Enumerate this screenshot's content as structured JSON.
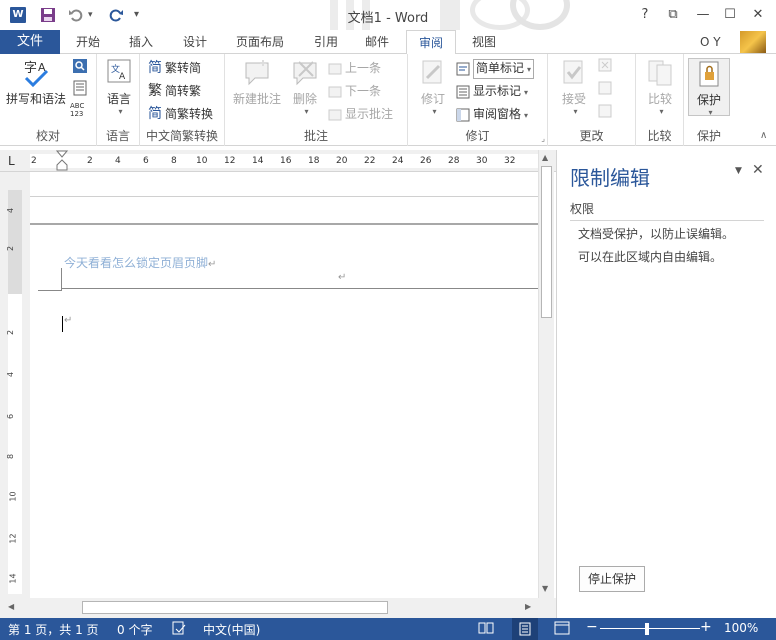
{
  "titlebar": {
    "title": "文档1 - Word",
    "logo": "W",
    "help": "?",
    "restore": "⧉",
    "minimize": "—",
    "maximize": "☐",
    "close": "✕"
  },
  "tabs": {
    "file": "文件",
    "items": [
      "开始",
      "插入",
      "设计",
      "页面布局",
      "引用",
      "邮件",
      "审阅",
      "视图"
    ],
    "active": "审阅",
    "user": "O Y"
  },
  "ribbon": {
    "proofing": {
      "label": "校对",
      "spelling": "拼写和语法",
      "abc": "ABC\n123"
    },
    "language": {
      "label": "语言"
    },
    "chinese": {
      "label": "中文简繁转换",
      "to_simplified": "繁转简",
      "to_traditional": "简转繁",
      "convert": "简繁转换",
      "icon_to_simplified": "简",
      "icon_to_traditional": "繁",
      "icon_convert": "简"
    },
    "comments": {
      "label": "批注",
      "new": "新建批注",
      "delete": "删除",
      "previous": "上一条",
      "next": "下一条",
      "show": "显示批注"
    },
    "tracking": {
      "label": "修订",
      "track": "修订",
      "simple_markup": "简单标记",
      "show_markup": "显示标记",
      "reviewing_pane": "审阅窗格"
    },
    "changes": {
      "label": "更改",
      "accept": "接受"
    },
    "compare": {
      "label": "比较",
      "compare": "比较"
    },
    "protect": {
      "label": "保护",
      "protect": "保护"
    }
  },
  "ruler": {
    "h_ticks": [
      "2",
      "2",
      "4",
      "6",
      "8",
      "10",
      "12",
      "14",
      "16",
      "18",
      "20",
      "22",
      "24",
      "26",
      "28",
      "30",
      "32"
    ],
    "v_ticks": [
      "4",
      "2",
      "2",
      "4",
      "6",
      "8",
      "10",
      "12",
      "14"
    ],
    "corner": "L"
  },
  "document": {
    "header_text": "今天看看怎么锁定页眉页脚",
    "para_mark": "↵"
  },
  "pane": {
    "title": "限制编辑",
    "section": "权限",
    "line1": "文档受保护，以防止误编辑。",
    "line2": "可以在此区域内自由编辑。",
    "stop_button": "停止保护"
  },
  "statusbar": {
    "pages": "第 1 页，共 1 页",
    "words": "0 个字",
    "language": "中文(中国)",
    "zoom": "100%"
  }
}
